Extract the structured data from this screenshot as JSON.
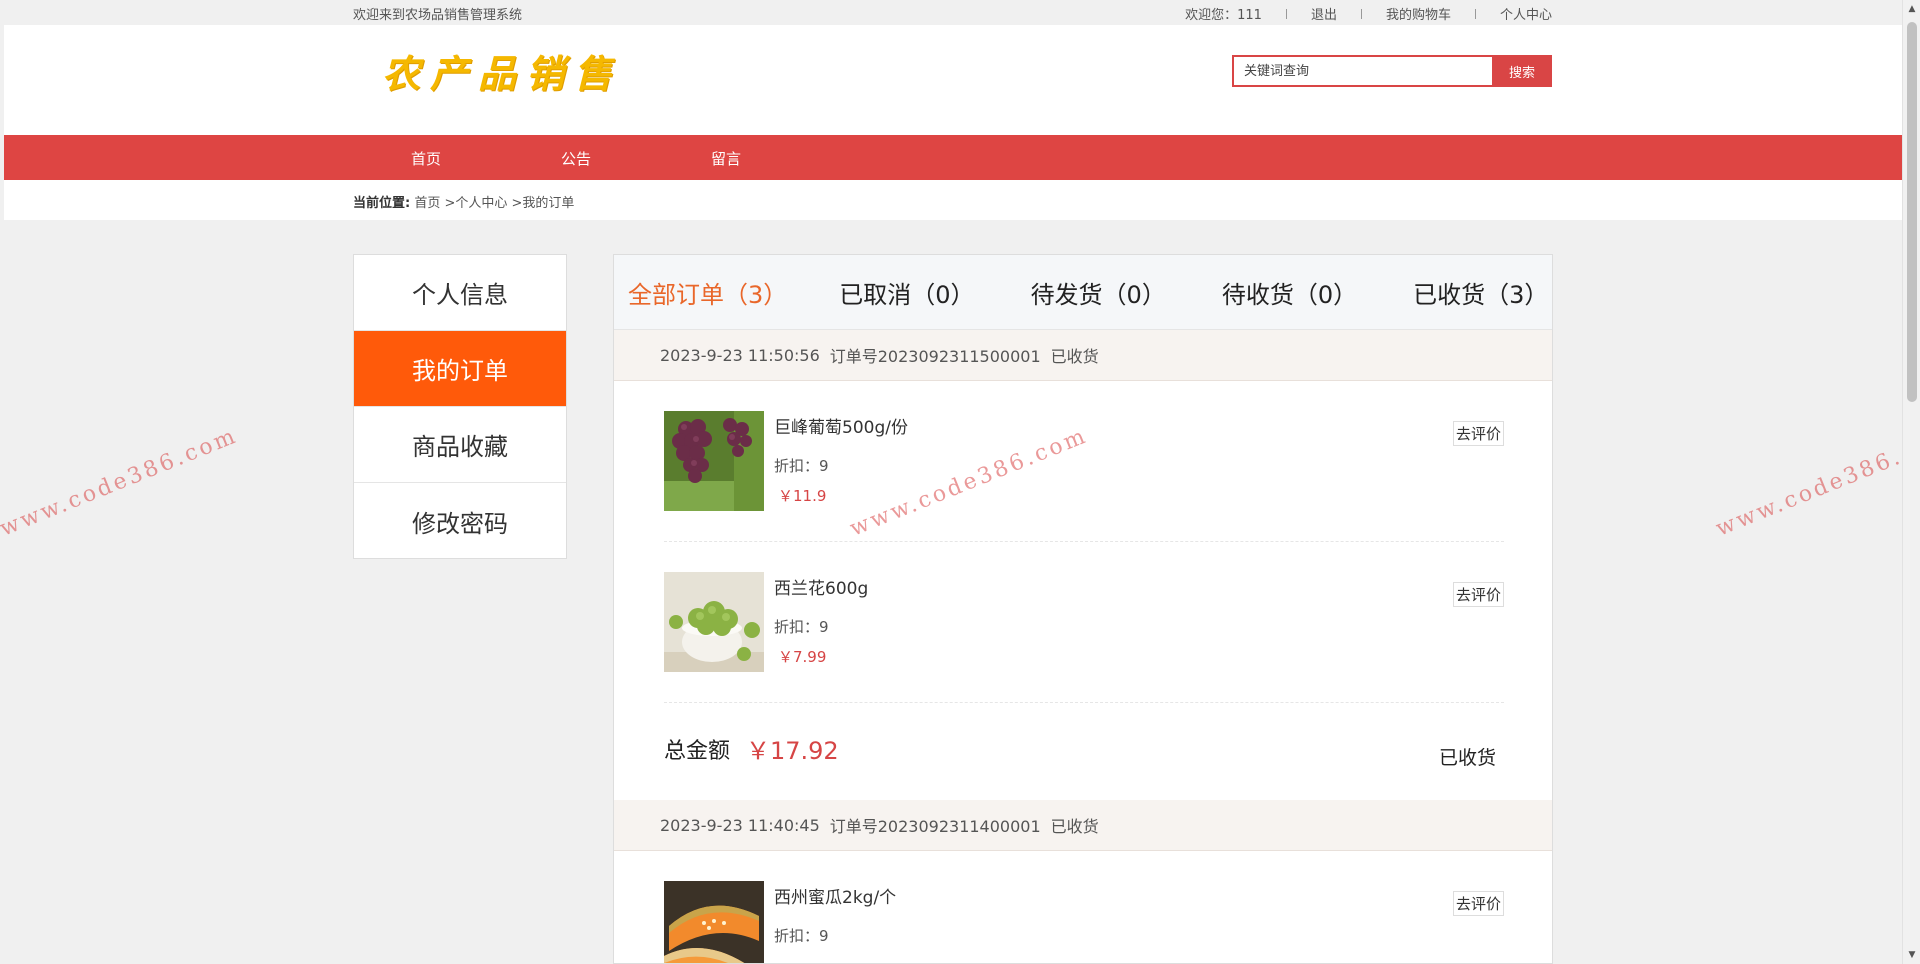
{
  "topbar": {
    "welcome": "欢迎来到农场品销售管理系统",
    "user_greeting": "欢迎您：111",
    "logout": "退出",
    "cart": "我的购物车",
    "personal_center": "个人中心"
  },
  "header": {
    "logo_text": "农产品销售",
    "search": {
      "placeholder": "关键词查询",
      "button": "搜索"
    }
  },
  "nav": {
    "items": [
      "首页",
      "公告",
      "留言"
    ]
  },
  "breadcrumb": {
    "label": "当前位置:",
    "path": "首页 >个人中心 >我的订单"
  },
  "sidebar": {
    "items": [
      {
        "label": "个人信息",
        "active": false
      },
      {
        "label": "我的订单",
        "active": true
      },
      {
        "label": "商品收藏",
        "active": false
      },
      {
        "label": "修改密码",
        "active": false
      }
    ]
  },
  "tabs": [
    {
      "label": "全部订单（3）",
      "active": true
    },
    {
      "label": "已取消（0）",
      "active": false
    },
    {
      "label": "待发货（0）",
      "active": false
    },
    {
      "label": "待收货（0）",
      "active": false
    },
    {
      "label": "已收货（3）",
      "active": false
    }
  ],
  "orders": [
    {
      "time": "2023-9-23 11:50:56",
      "order_no": "订单号2023092311500001",
      "status": "已收货",
      "items": [
        {
          "name": "巨峰葡萄500g/份",
          "discount": "折扣：9",
          "price": "￥11.9",
          "action": "去评价",
          "image": "grapes"
        },
        {
          "name": "西兰花600g",
          "discount": "折扣：9",
          "price": "￥7.99",
          "action": "去评价",
          "image": "broccoli"
        }
      ],
      "total_label": "总金额",
      "total_amount": "￥17.92",
      "total_status": "已收货"
    },
    {
      "time": "2023-9-23 11:40:45",
      "order_no": "订单号2023092311400001",
      "status": "已收货",
      "items": [
        {
          "name": "西州蜜瓜2kg/个",
          "discount": "折扣：9",
          "price": "",
          "action": "去评价",
          "image": "melon"
        }
      ]
    }
  ],
  "watermark": "www.code386.com",
  "colors": {
    "accent_red": "#de4543",
    "active_orange": "#ff5a0a",
    "tab_active": "#e9672a",
    "price_red": "#d64545",
    "logo_yellow": "#f5b800"
  }
}
